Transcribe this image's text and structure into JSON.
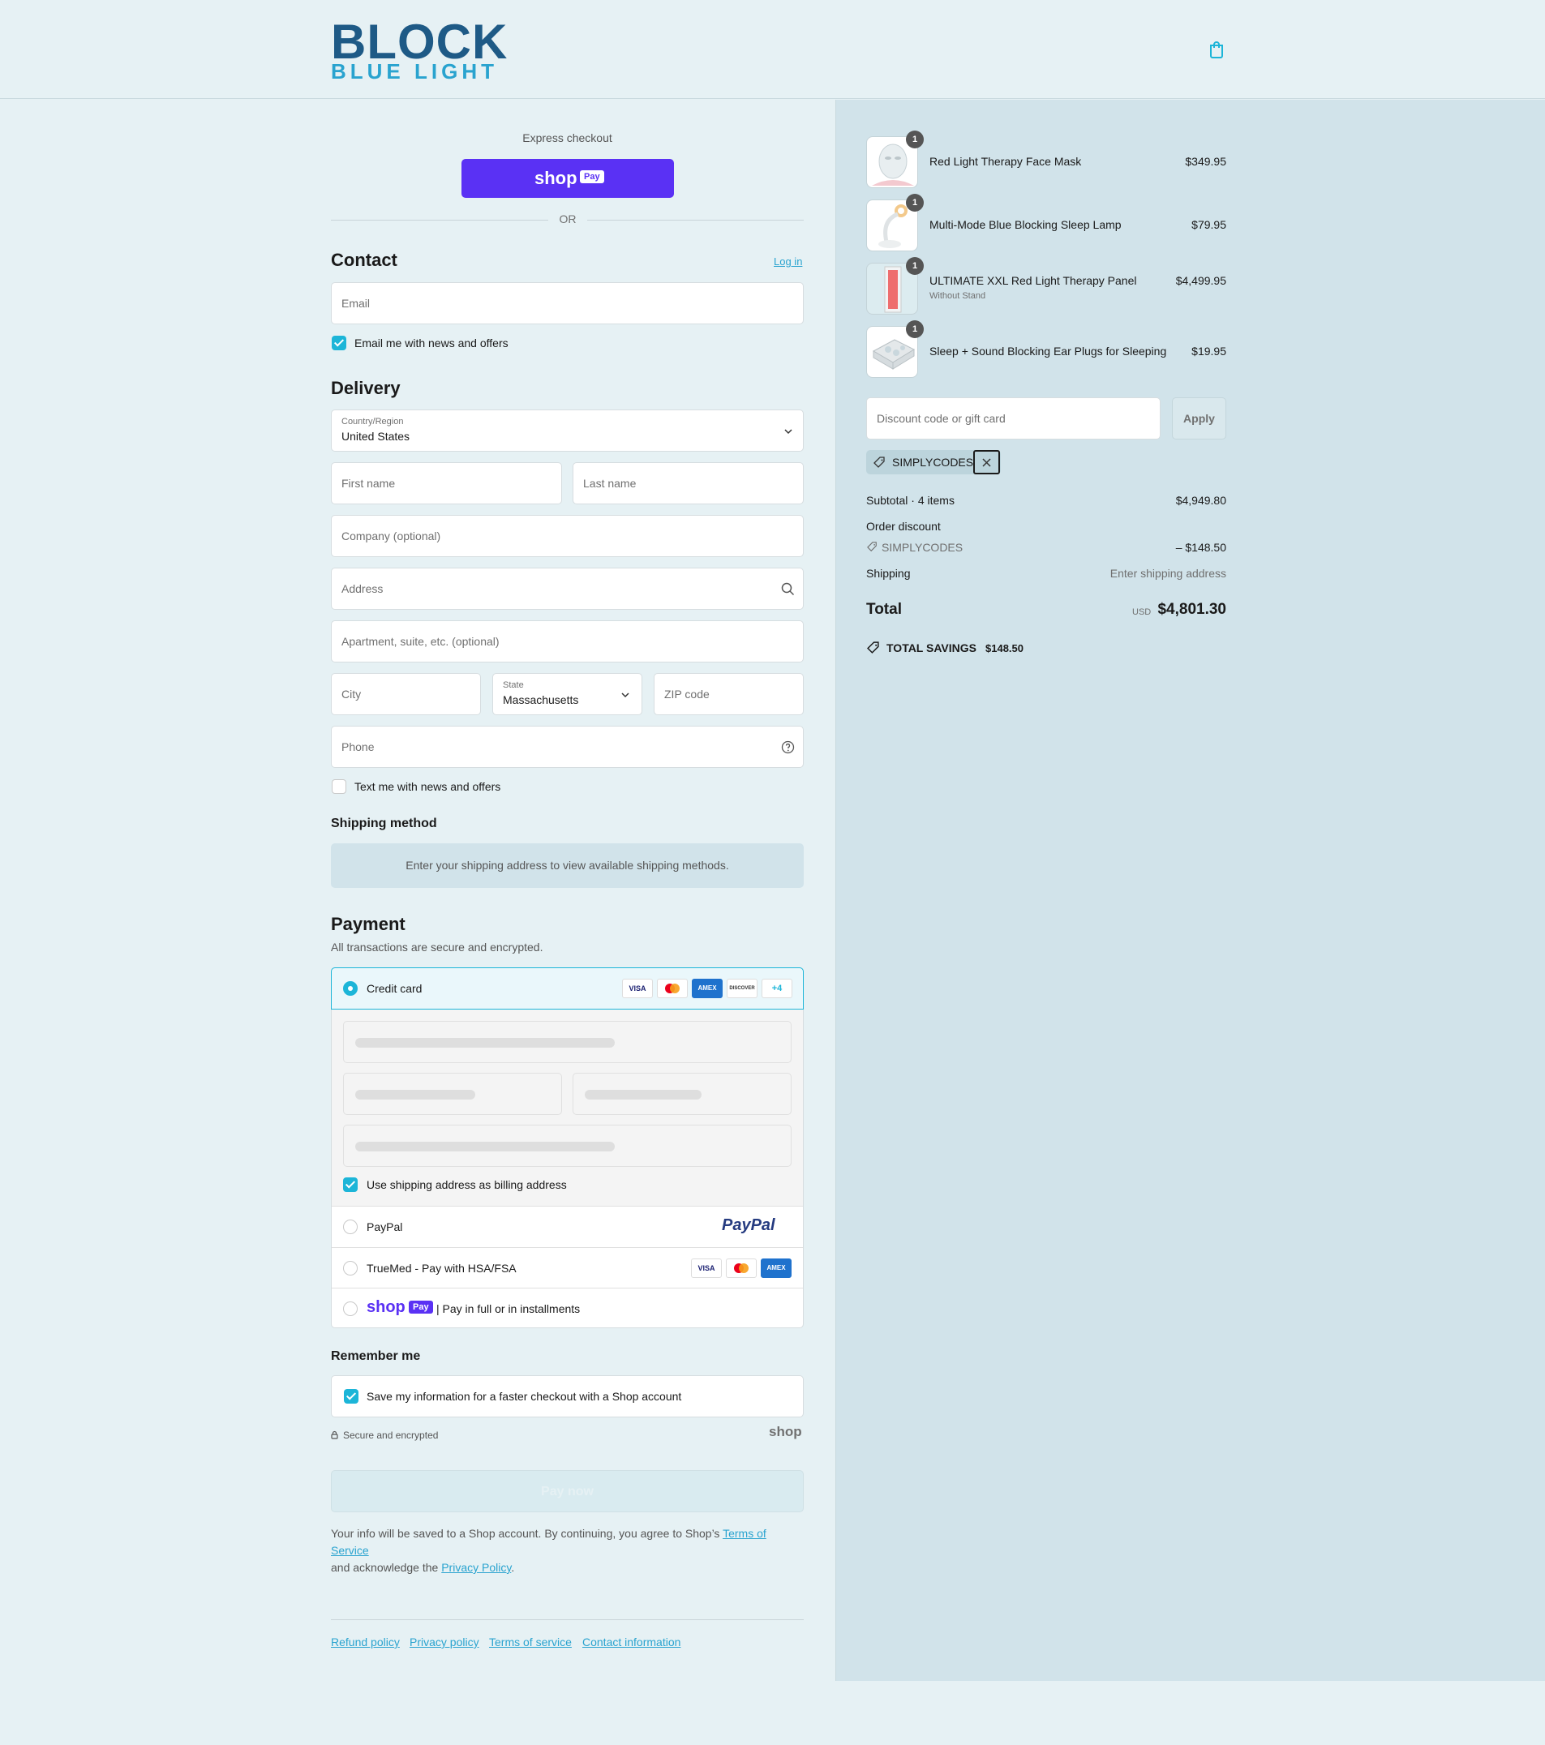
{
  "brand": {
    "logo_top": "BLOCK",
    "logo_bottom": "BLUE LIGHT",
    "accent": "#1cb5d8",
    "dark_blue": "#1e5a86"
  },
  "express": {
    "label": "Express checkout",
    "shop_text": "shop",
    "pay_text": "Pay",
    "or": "OR"
  },
  "contact": {
    "title": "Contact",
    "login": "Log in",
    "email_placeholder": "Email",
    "news_label": "Email me with news and offers",
    "news_checked": true
  },
  "delivery": {
    "title": "Delivery",
    "country_label": "Country/Region",
    "country_value": "United States",
    "first_name": "First name",
    "last_name": "Last name",
    "company": "Company (optional)",
    "address": "Address",
    "apartment": "Apartment, suite, etc. (optional)",
    "city": "City",
    "state_label": "State",
    "state_value": "Massachusetts",
    "zip": "ZIP code",
    "phone": "Phone",
    "text_label": "Text me with news and offers",
    "text_checked": false
  },
  "shipping_method": {
    "title": "Shipping method",
    "message": "Enter your shipping address to view available shipping methods."
  },
  "payment": {
    "title": "Payment",
    "subtitle": "All transactions are secure and encrypted.",
    "credit_card": "Credit card",
    "cards": [
      "VISA",
      "MC",
      "AMEX",
      "DISCOVER",
      "+4"
    ],
    "billing_label": "Use shipping address as billing address",
    "paypal": "PayPal",
    "paypal_logo": "PayPal",
    "truemed": "TrueMed - Pay with HSA/FSA",
    "shop_installments": "| Pay in full or in installments",
    "shop_text": "shop",
    "pay_text": "Pay"
  },
  "remember": {
    "title": "Remember me",
    "save_label": "Save my information for a faster checkout with a Shop account",
    "secure": "Secure and encrypted",
    "shop": "shop"
  },
  "pay_now": "Pay now",
  "legal": {
    "text1": "Your info will be saved to a Shop account. By continuing, you agree to Shop’s ",
    "terms": "Terms of Service",
    "text2": "and acknowledge the ",
    "privacy": "Privacy Policy",
    "text3": "."
  },
  "footer": [
    "Refund policy",
    "Privacy policy",
    "Terms of service",
    "Contact information"
  ],
  "summary": {
    "items": [
      {
        "name": "Red Light Therapy Face Mask",
        "variant": "",
        "qty": "1",
        "price": "$349.95"
      },
      {
        "name": "Multi-Mode Blue Blocking Sleep Lamp",
        "variant": "",
        "qty": "1",
        "price": "$79.95"
      },
      {
        "name": "ULTIMATE XXL Red Light Therapy Panel",
        "variant": "Without Stand",
        "qty": "1",
        "price": "$4,499.95"
      },
      {
        "name": "Sleep + Sound Blocking Ear Plugs for Sleeping",
        "variant": "",
        "qty": "1",
        "price": "$19.95"
      }
    ],
    "discount_placeholder": "Discount code or gift card",
    "apply": "Apply",
    "code": "SIMPLYCODES",
    "subtotal_label": "Subtotal · 4 items",
    "subtotal": "$4,949.80",
    "order_discount": "Order discount",
    "discount_code": "SIMPLYCODES",
    "discount_value": "– $148.50",
    "shipping_label": "Shipping",
    "shipping_value": "Enter shipping address",
    "total_label": "Total",
    "currency": "USD",
    "total": "$4,801.30",
    "savings_label": "TOTAL SAVINGS",
    "savings": "$148.50"
  }
}
